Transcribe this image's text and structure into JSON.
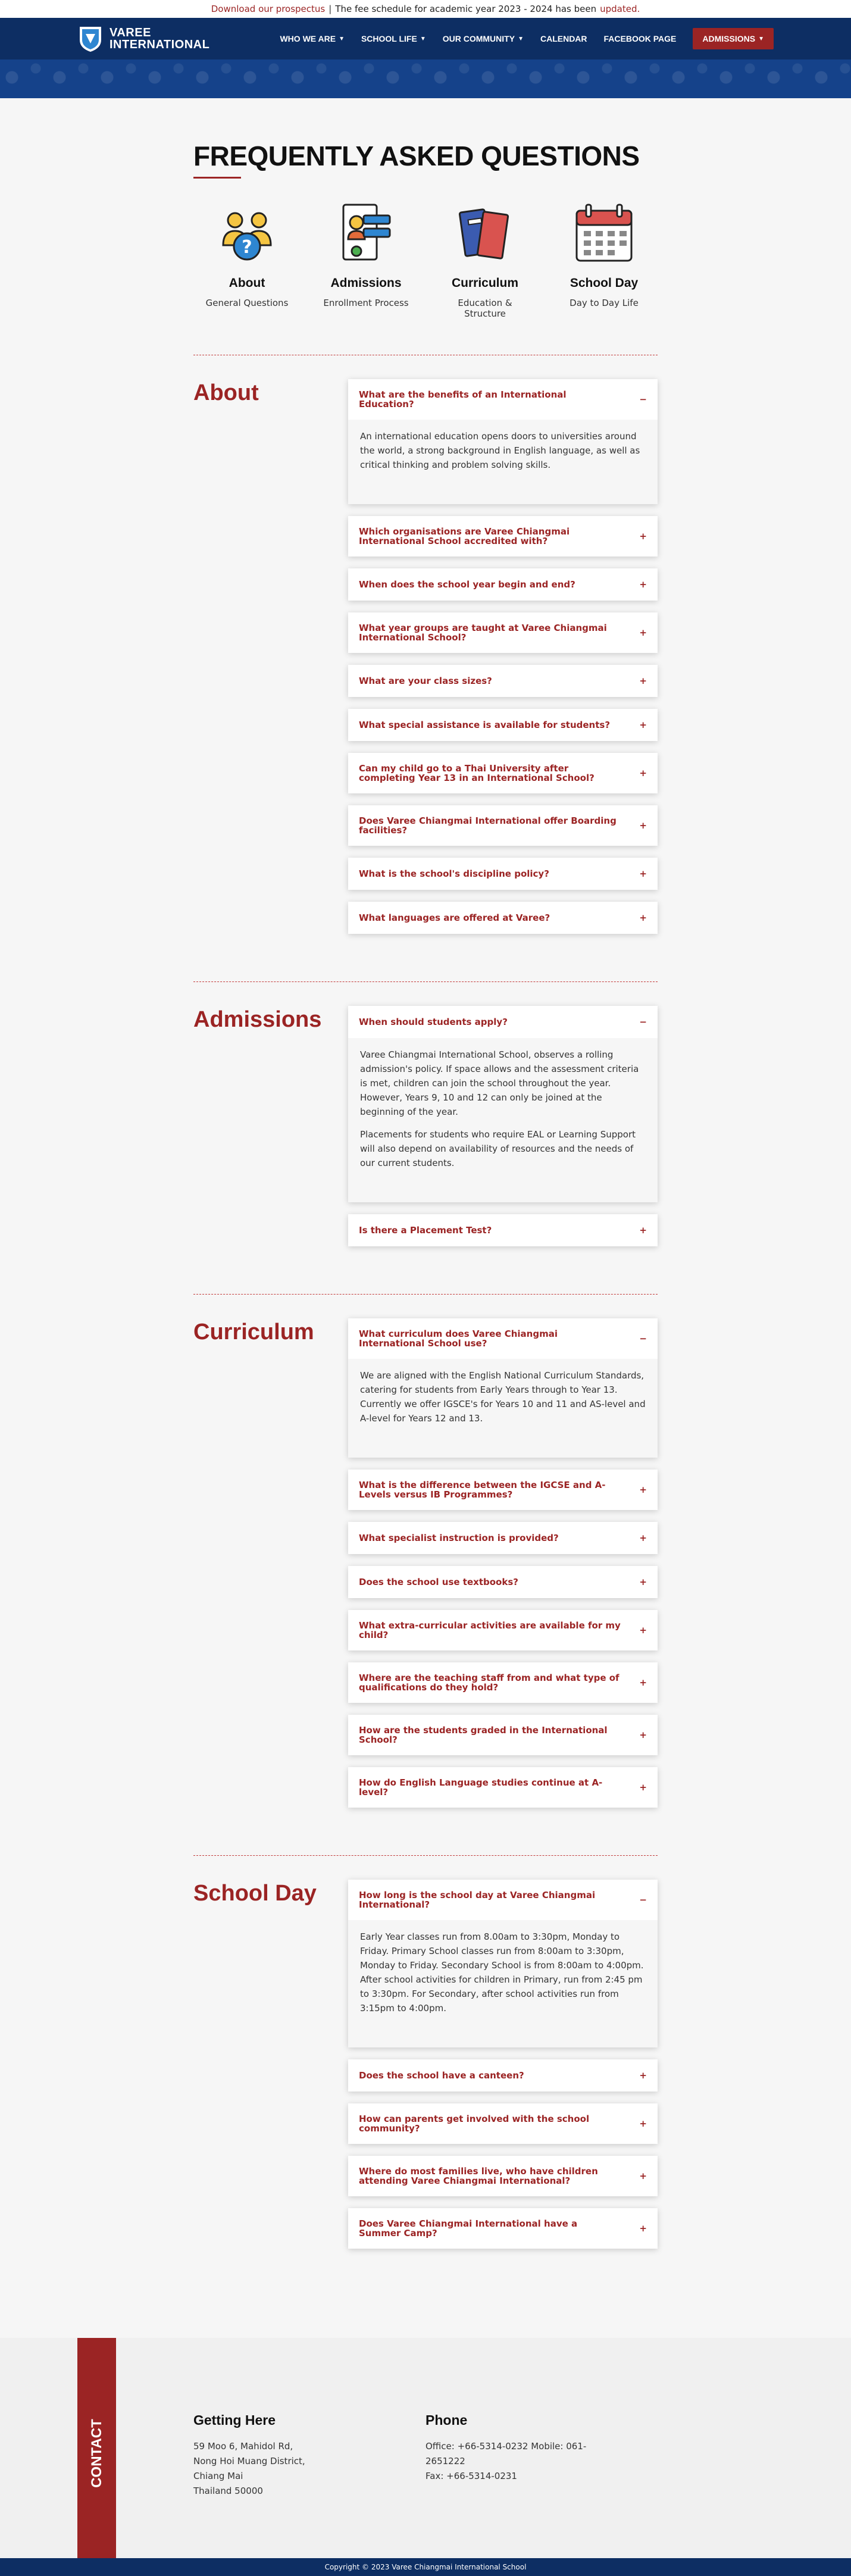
{
  "topbar": {
    "prospectus": "Download our prospectus",
    "separator": "|",
    "notice": "The fee schedule for academic year 2023 - 2024 has been",
    "notice_link": "updated."
  },
  "header": {
    "logo_line1": "VAREE",
    "logo_line2": "INTERNATIONAL",
    "nav": [
      {
        "label": "WHO WE ARE",
        "dropdown": true
      },
      {
        "label": "SCHOOL LIFE",
        "dropdown": true
      },
      {
        "label": "OUR COMMUNITY",
        "dropdown": true
      },
      {
        "label": "CALENDAR",
        "dropdown": false
      },
      {
        "label": "FACEBOOK PAGE",
        "dropdown": false
      }
    ],
    "cta": "ADMISSIONS",
    "brand_color": "#0d2e63",
    "accent_color": "#9b2424"
  },
  "page_title": "FREQUENTLY ASKED QUESTIONS",
  "categories": [
    {
      "title": "About",
      "subtitle": "General Questions",
      "icon": "people-question-icon"
    },
    {
      "title": "Admissions",
      "subtitle": "Enrollment Process",
      "icon": "id-document-icon"
    },
    {
      "title": "Curriculum",
      "subtitle": "Education & Structure",
      "icon": "books-icon"
    },
    {
      "title": "School Day",
      "subtitle": "Day to Day Life",
      "icon": "calendar-icon"
    }
  ],
  "sections": [
    {
      "title": "About",
      "faqs": [
        {
          "q": "What are the benefits of an International Education?",
          "open": true,
          "a": [
            "An international education opens doors to universities around the world, a strong background in English language, as well as critical thinking and problem solving skills."
          ]
        },
        {
          "q": "Which organisations are Varee Chiangmai International School accredited with?"
        },
        {
          "q": "When does the school year begin and end?"
        },
        {
          "q": "What year groups are taught at Varee Chiangmai International School?"
        },
        {
          "q": "What are your class sizes?"
        },
        {
          "q": "What special assistance is available for students?"
        },
        {
          "q": "Can my child go to a Thai University after completing Year 13 in an International School?"
        },
        {
          "q": "Does Varee Chiangmai International offer Boarding facilities?"
        },
        {
          "q": "What is the school's discipline policy?"
        },
        {
          "q": "What languages are offered at Varee?"
        }
      ]
    },
    {
      "title": "Admissions",
      "faqs": [
        {
          "q": "When should students apply?",
          "open": true,
          "a": [
            "Varee Chiangmai International School, observes a rolling admission's policy. If space allows and the assessment criteria is met, children can join the school throughout the year. However, Years 9, 10 and 12 can only be joined at the beginning of the year.",
            "Placements for students who require EAL or Learning Support will also depend on availability of resources and the needs of our current students."
          ]
        },
        {
          "q": "Is there a Placement Test?"
        }
      ]
    },
    {
      "title": "Curriculum",
      "faqs": [
        {
          "q": "What curriculum does Varee Chiangmai International School use?",
          "open": true,
          "a": [
            "We are aligned with the English National Curriculum Standards, catering for students from Early Years through to Year 13. Currently we offer IGSCE's for Years 10 and 11 and AS-level and A-level for Years 12 and 13."
          ]
        },
        {
          "q": "What is the difference between the IGCSE and A-Levels versus IB Programmes?"
        },
        {
          "q": "What specialist instruction is provided?"
        },
        {
          "q": "Does the school use textbooks?"
        },
        {
          "q": "What extra-curricular activities are available for my child?"
        },
        {
          "q": "Where are the teaching staff from and what type of qualifications do they hold?"
        },
        {
          "q": "How are the students graded in the International School?"
        },
        {
          "q": "How do English Language studies continue at A-level?"
        }
      ]
    },
    {
      "title": "School Day",
      "faqs": [
        {
          "q": "How long is the school day at Varee Chiangmai International?",
          "open": true,
          "a": [
            "Early Year classes run from 8.00am to 3:30pm, Monday to Friday. Primary School classes run from 8:00am to 3:30pm, Monday to Friday. Secondary School is from 8:00am to 4:00pm.  After school activities for children in Primary, run from 2:45 pm to 3:30pm. For Secondary, after school activities run from 3:15pm to 4:00pm."
          ]
        },
        {
          "q": "Does the school have a canteen?"
        },
        {
          "q": "How can parents get involved with the school community?"
        },
        {
          "q": "Where do most families live, who have children attending Varee Chiangmai International?"
        },
        {
          "q": "Does Varee Chiangmai International have a Summer Camp?"
        }
      ]
    }
  ],
  "footer": {
    "contact_label": "CONTACT",
    "address_title": "Getting Here",
    "address_lines": [
      "59 Moo 6, Mahidol Rd,",
      "Nong Hoi Muang District,",
      "Chiang Mai",
      "Thailand 50000"
    ],
    "phone_title": "Phone",
    "phone_lines": [
      "Office: +66-5314-0232 Mobile: 061-2651222",
      "Fax: +66-5314-0231"
    ],
    "copyright": "Copyright © 2023 Varee Chiangmai International School"
  }
}
